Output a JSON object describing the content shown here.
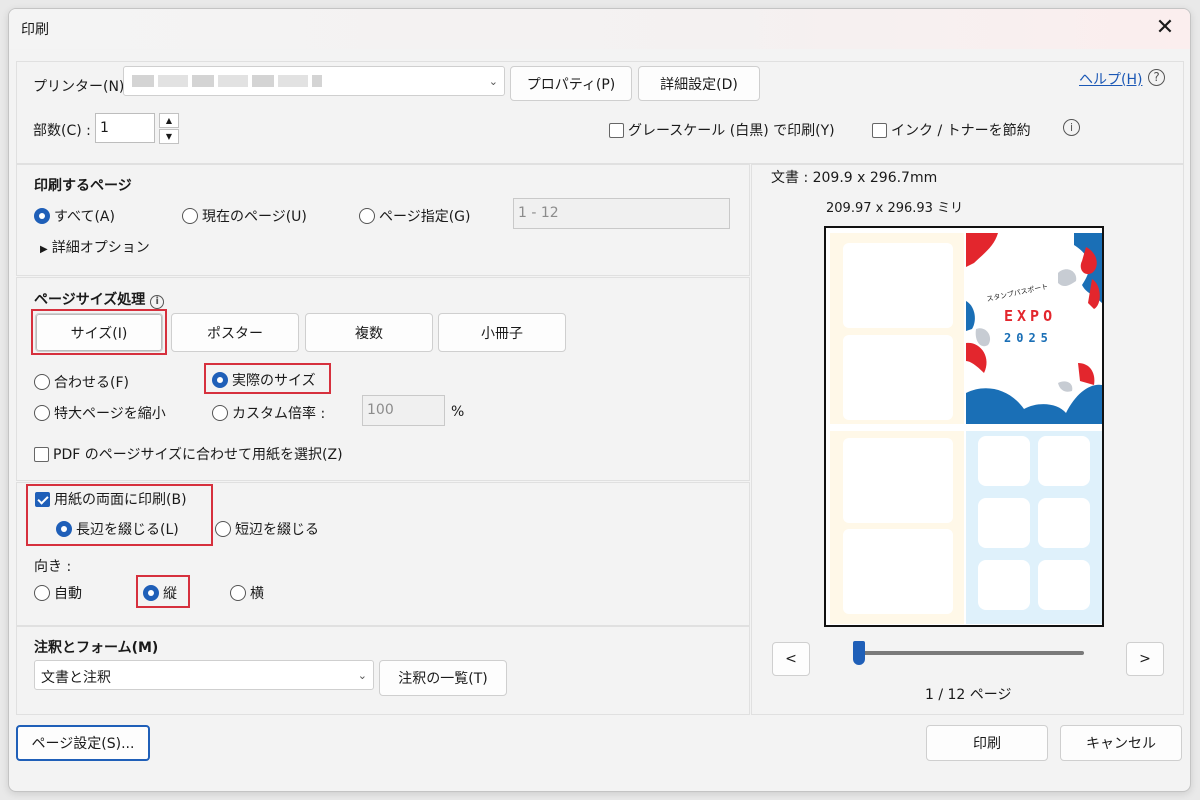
{
  "dialog": {
    "title": "印刷",
    "close_glyph": "✕"
  },
  "printer": {
    "label": "プリンター(N) :",
    "value": "",
    "properties_button": "プロパティ(P)",
    "advanced_button": "詳細設定(D)",
    "help_link": "ヘルプ(H)",
    "help_icon": "?"
  },
  "copies": {
    "label": "部数(C) :",
    "value": "1",
    "up_glyph": "▲",
    "down_glyph": "▼"
  },
  "options": {
    "grayscale_label": "グレースケール (白黒) で印刷(Y)",
    "grayscale_checked": false,
    "save_ink_label": "インク / トナーを節約",
    "save_ink_checked": false,
    "info_glyph": "i"
  },
  "pages_to_print": {
    "title": "印刷するページ",
    "all_label": "すべて(A)",
    "current_label": "現在のページ(U)",
    "range_label": "ページ指定(G)",
    "range_value": "1 - 12",
    "selected": "all",
    "more_options_label": "詳細オプション",
    "more_options_glyph": "▶"
  },
  "page_sizing": {
    "title": "ページサイズ処理",
    "tabs": [
      "サイズ(I)",
      "ポスター",
      "複数",
      "小冊子"
    ],
    "selected_tab": "サイズ(I)",
    "fit_label": "合わせる(F)",
    "actual_size_label": "実際のサイズ",
    "shrink_label": "特大ページを縮小",
    "custom_scale_label": "カスタム倍率 :",
    "custom_scale_value": "100",
    "percent": "%",
    "selected": "actual_size",
    "pdf_paper_label": "PDF のページサイズに合わせて用紙を選択(Z)",
    "pdf_paper_checked": false
  },
  "duplex": {
    "label": "用紙の両面に印刷(B)",
    "checked": true,
    "long_edge_label": "長辺を綴じる(L)",
    "short_edge_label": "短辺を綴じる",
    "selected": "long_edge"
  },
  "orientation": {
    "label": "向き :",
    "auto_label": "自動",
    "portrait_label": "縦",
    "landscape_label": "横",
    "selected": "portrait"
  },
  "comments": {
    "title": "注釈とフォーム(M)",
    "value": "文書と注釈",
    "summary_button": "注釈の一覧(T)"
  },
  "preview": {
    "doc_size": "文書 : 209.9 x 296.7mm",
    "paper_size": "209.97 x 296.93 ミリ",
    "prev_glyph": "<",
    "next_glyph": ">",
    "page_indicator": "1 / 12 ページ",
    "page_position": 0.0,
    "poster_title_jp": "スタンプパスポート",
    "poster_expo": "EXPO",
    "poster_year": "2025"
  },
  "footer": {
    "page_setup_button": "ページ設定(S)...",
    "print_button": "印刷",
    "cancel_button": "キャンセル"
  },
  "colors": {
    "accent": "#1f5fb8",
    "highlight": "#d6303d",
    "expo_red": "#e3262d",
    "expo_blue": "#1a6fb6"
  }
}
